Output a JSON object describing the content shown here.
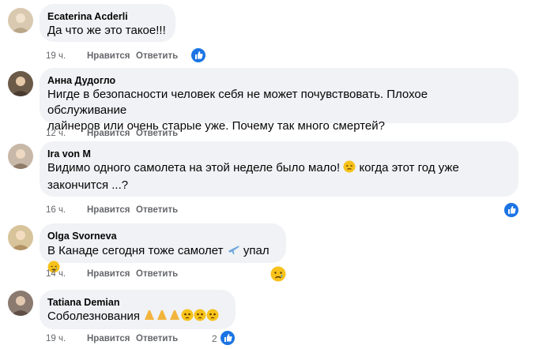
{
  "actions": {
    "like": "Нравится",
    "reply": "Ответить"
  },
  "comments": [
    {
      "author": "Ecaterina Acderli",
      "text": "Да что же это такое!!!",
      "time": "19 ч.",
      "reaction": "like",
      "reaction_count": ""
    },
    {
      "author": "Анна Дудогло",
      "text_line1": "Нигде в безопасности человек себя не может почувствовать. Плохое обслуживание",
      "text_line2": "лайнеров или очень старые уже. Почему так много смертей?",
      "time": "12 ч.",
      "reaction": "",
      "reaction_count": ""
    },
    {
      "author": "Ira von M",
      "text_line1": "Видимо одного самолета на этой неделе было мало!",
      "text_line1b": "когда этот год уже",
      "text_line2": "закончится ...?",
      "time": "16 ч.",
      "reaction": "like",
      "reaction_count": ""
    },
    {
      "author": "Olga Svorneva",
      "text_a": "В Канаде сегодня тоже самолет",
      "text_b": "упал",
      "time": "14 ч.",
      "reaction": "sad",
      "reaction_count": ""
    },
    {
      "author": "Tatiana Demian",
      "text": "Соболезнования",
      "time": "19 ч.",
      "reaction": "like",
      "reaction_count": "2"
    }
  ],
  "colors": {
    "bubble": "#f0f2f5",
    "meta": "#65676b",
    "like_blue": "#1b74e4"
  }
}
